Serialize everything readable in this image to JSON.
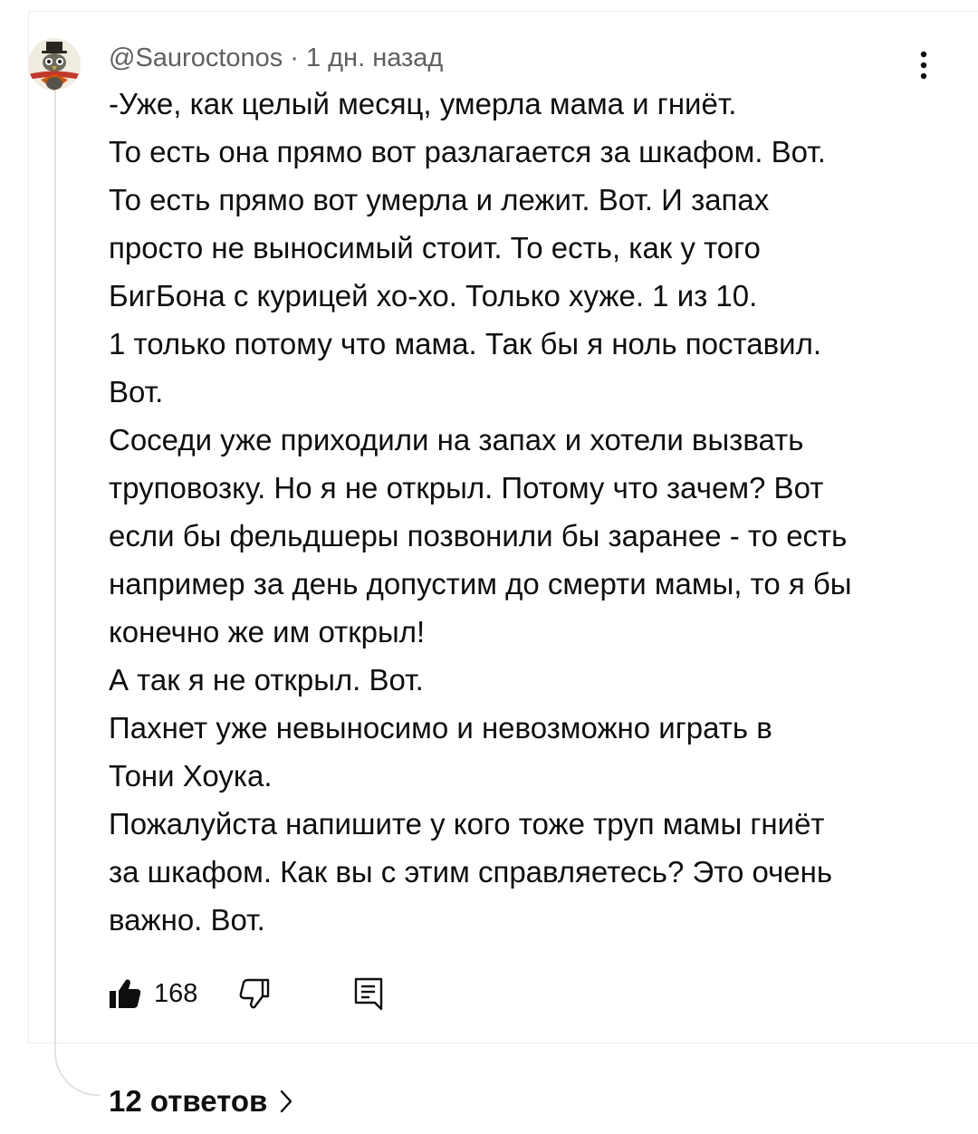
{
  "comment": {
    "author": "@Sauroctonos",
    "separator": "·",
    "timestamp": "1 дн. назад",
    "lines": [
      "-Уже, как целый месяц, умерла мама и гниёт.",
      "То есть она прямо вот разлагается за шкафом. Вот.",
      "То есть прямо вот умерла и лежит. Вот. И запах",
      "просто не выносимый стоит. То есть, как у того",
      "БигБона с курицей хо-хо. Только хуже. 1 из 10.",
      "1 только потому что мама. Так бы я ноль поставил.",
      "Вот.",
      "Соседи уже приходили на запах и хотели вызвать",
      "труповозку. Но я не открыл. Потому что зачем? Вот",
      "если бы фельдшеры позвонили бы заранее - то есть",
      "например за день допустим до смерти мамы, то я бы",
      "конечно же им открыл!",
      "А так я не открыл. Вот.",
      "Пахнет уже невыносимо и невозможно играть в",
      "Тони Хоука.",
      "Пожалуйста напишите у кого тоже труп мамы гниёт",
      "за шкафом. Как вы с этим справляетесь? Это очень",
      "важно. Вот."
    ],
    "like_count": "168",
    "replies_label": "12 ответов"
  },
  "icons": {
    "avatar": "avatar-bird-icon",
    "menu": "more-vertical-icon",
    "like": "thumbs-up-filled-icon",
    "dislike": "thumbs-down-outline-icon",
    "reply": "reply-comment-icon",
    "replies_chevron": "chevron-right-icon"
  },
  "colors": {
    "text": "#0f0f0f",
    "meta": "#606060",
    "border": "#ececec",
    "thread_line": "#e2e2e2"
  }
}
